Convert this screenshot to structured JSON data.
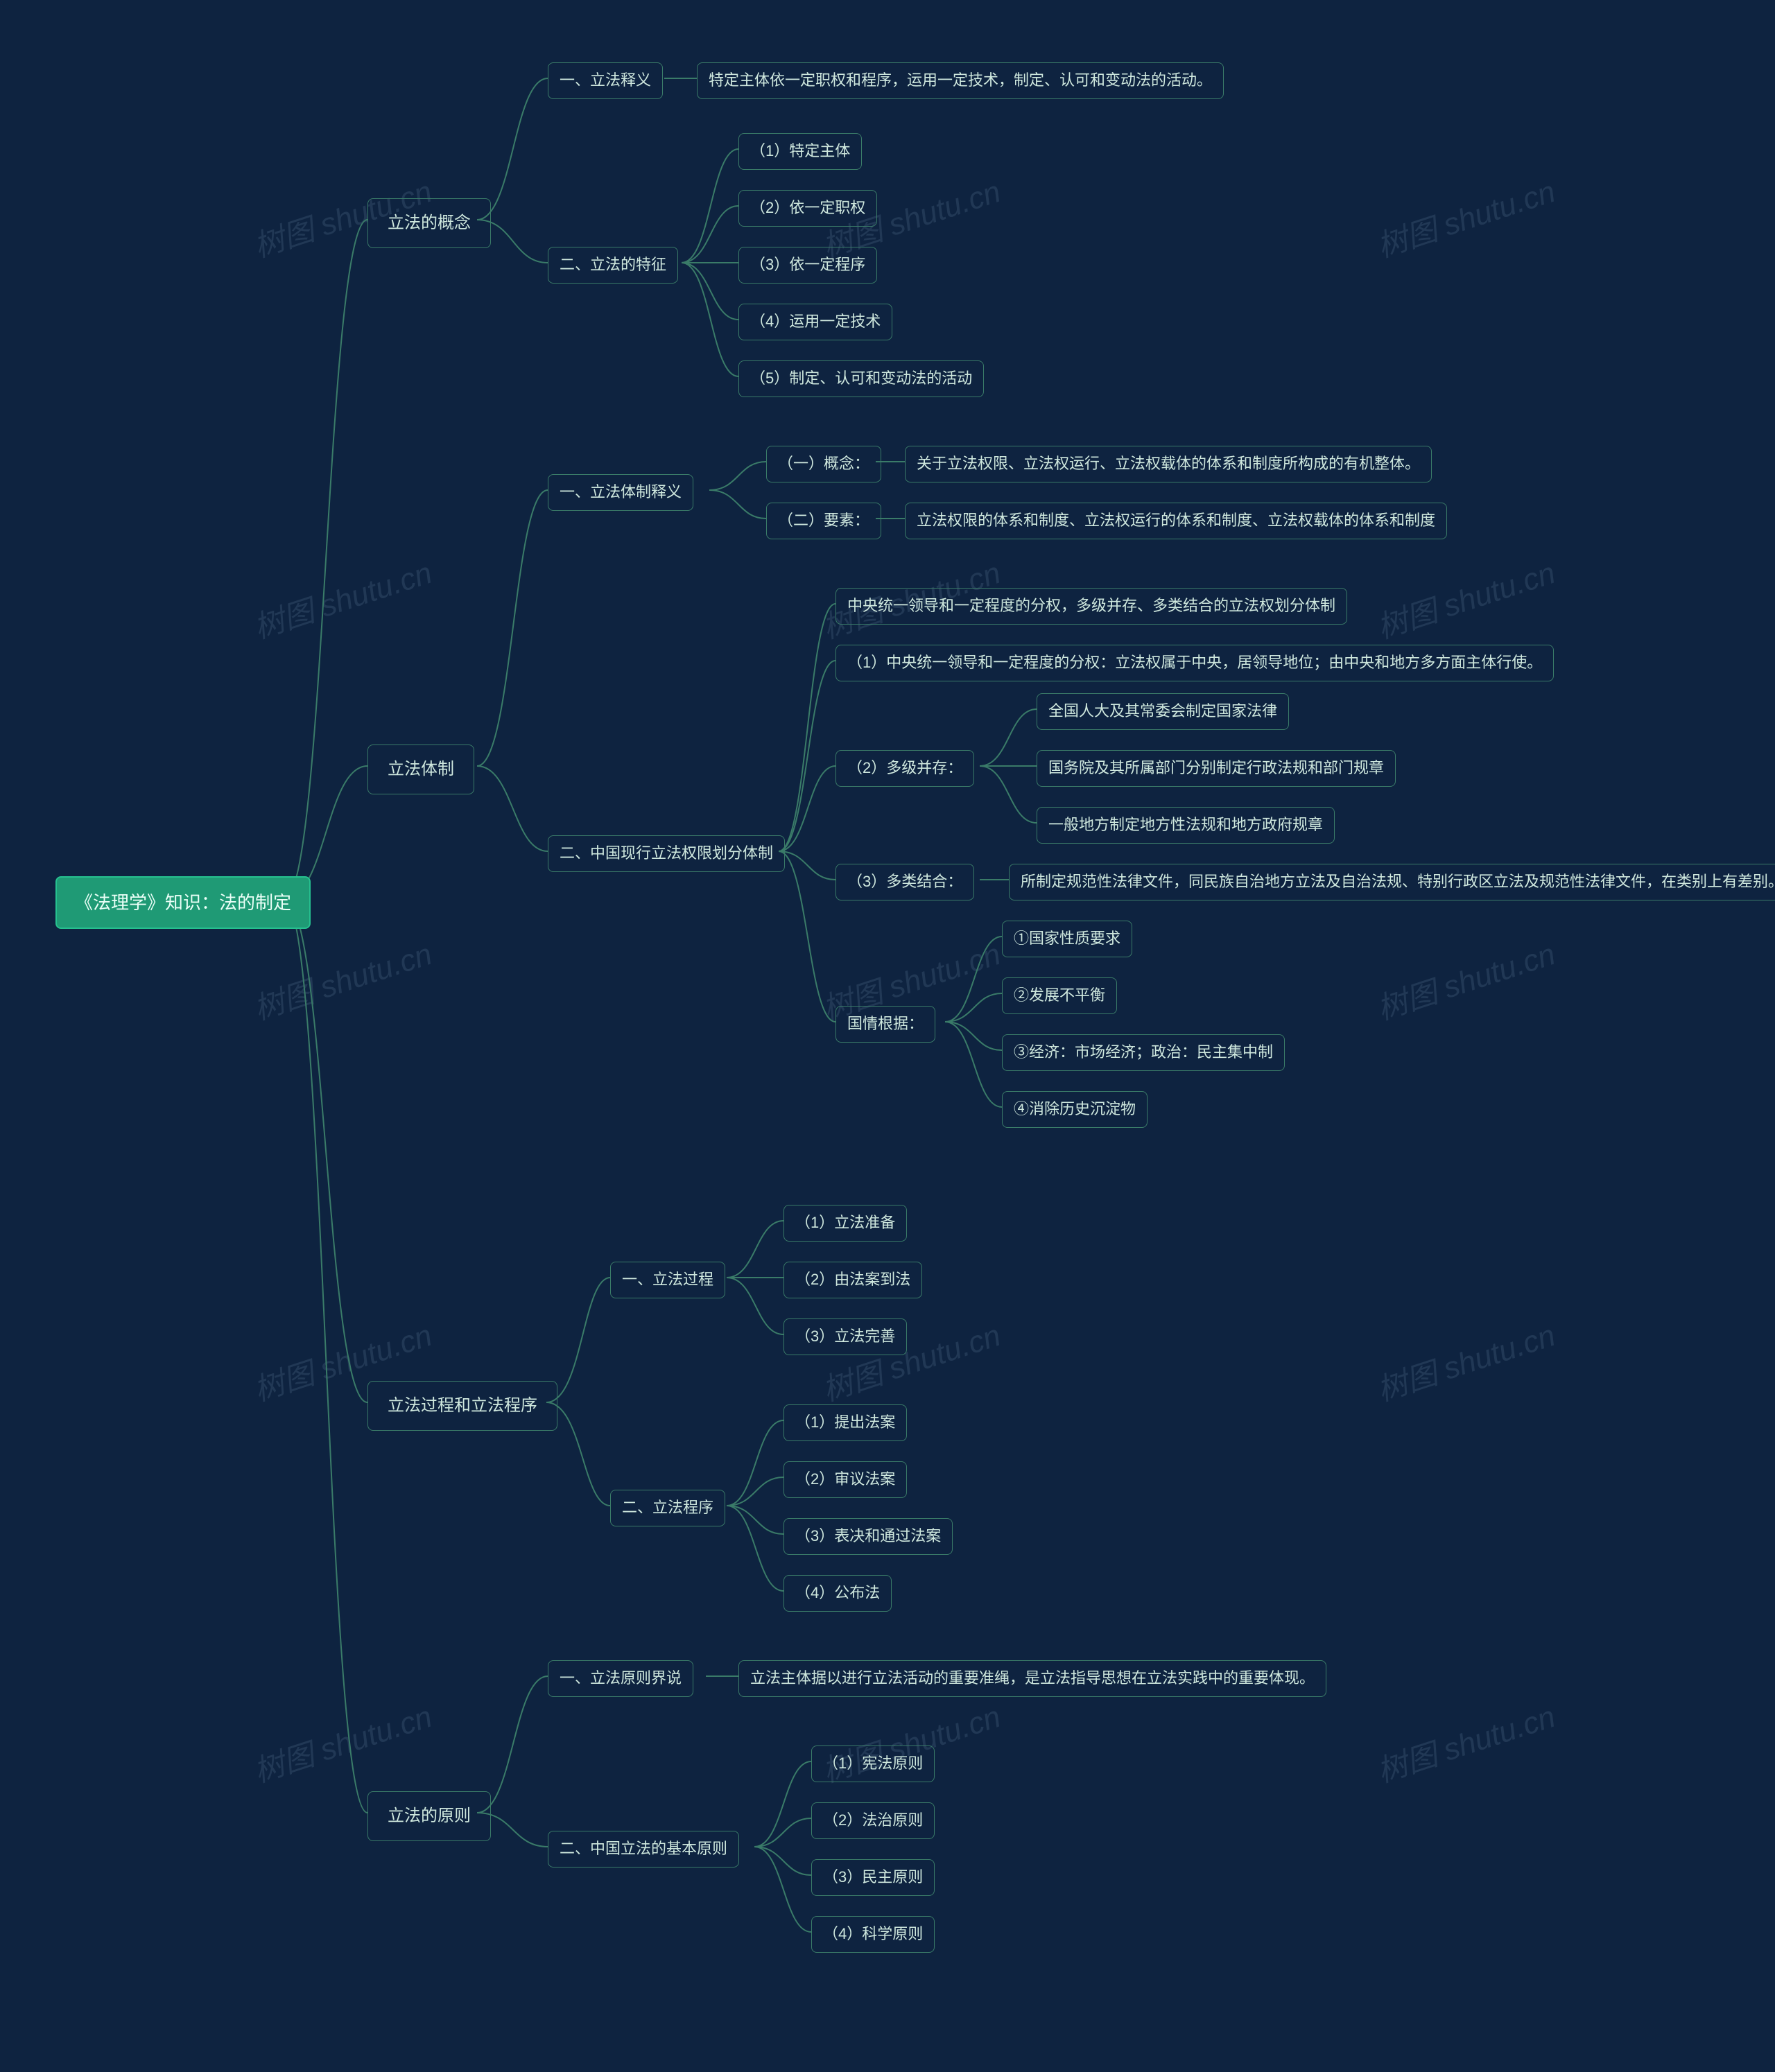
{
  "watermark_text": "树图 shutu.cn",
  "root": {
    "label": "《法理学》知识：法的制定"
  },
  "s1": {
    "title": "立法的概念",
    "b1": {
      "title": "一、立法释义",
      "detail": "特定主体依一定职权和程序，运用一定技术，制定、认可和变动法的活动。"
    },
    "b2": {
      "title": "二、立法的特征",
      "i1": "（1）特定主体",
      "i2": "（2）依一定职权",
      "i3": "（3）依一定程序",
      "i4": "（4）运用一定技术",
      "i5": "（5）制定、认可和变动法的活动"
    }
  },
  "s2": {
    "title": "立法体制",
    "b1": {
      "title": "一、立法体制释义",
      "i1": {
        "label": "（一）概念：",
        "detail": "关于立法权限、立法权运行、立法权载体的体系和制度所构成的有机整体。"
      },
      "i2": {
        "label": "（二）要素：",
        "detail": "立法权限的体系和制度、立法权运行的体系和制度、立法权载体的体系和制度"
      }
    },
    "b2": {
      "title": "二、中国现行立法权限划分体制",
      "top": "中央统一领导和一定程度的分权，多级并存、多类结合的立法权划分体制",
      "p1": "（1）中央统一领导和一定程度的分权：立法权属于中央，居领导地位；由中央和地方多方面主体行使。",
      "p2": {
        "label": "（2）多级并存：",
        "a": "全国人大及其常委会制定国家法律",
        "b": "国务院及其所属部门分别制定行政法规和部门规章",
        "c": "一般地方制定地方性法规和地方政府规章"
      },
      "p3": {
        "label": "（3）多类结合：",
        "detail": "所制定规范性法律文件，同民族自治地方立法及自治法规、特别行政区立法及规范性法律文件，在类别上有差别。"
      },
      "basis": {
        "label": "国情根据：",
        "a": "①国家性质要求",
        "b": "②发展不平衡",
        "c": "③经济：市场经济；政治：民主集中制",
        "d": "④消除历史沉淀物"
      }
    }
  },
  "s3": {
    "title": "立法过程和立法程序",
    "b1": {
      "title": "一、立法过程",
      "i1": "（1）立法准备",
      "i2": "（2）由法案到法",
      "i3": "（3）立法完善"
    },
    "b2": {
      "title": "二、立法程序",
      "i1": "（1）提出法案",
      "i2": "（2）审议法案",
      "i3": "（3）表决和通过法案",
      "i4": "（4）公布法"
    }
  },
  "s4": {
    "title": "立法的原则",
    "b1": {
      "title": "一、立法原则界说",
      "detail": "立法主体据以进行立法活动的重要准绳，是立法指导思想在立法实践中的重要体现。"
    },
    "b2": {
      "title": "二、中国立法的基本原则",
      "i1": "（1）宪法原则",
      "i2": "（2）法治原则",
      "i3": "（3）民主原则",
      "i4": "（4）科学原则"
    }
  }
}
